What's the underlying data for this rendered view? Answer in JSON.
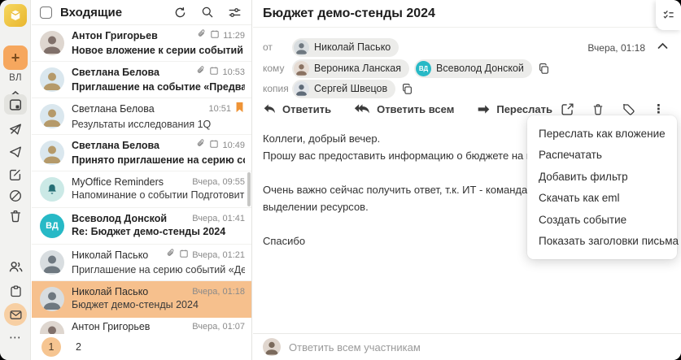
{
  "rail": {
    "logo_name": "myoffice-mail-logo",
    "compose_label": "+",
    "profile_initials": "ВЛ",
    "folders": [
      "inbox",
      "outbox",
      "sent",
      "drafts",
      "spam",
      "trash"
    ],
    "apps": [
      "contacts",
      "calendar",
      "mail",
      "more"
    ],
    "more_glyph": "⋯"
  },
  "icons": {
    "kebab_glyph": "⋮"
  },
  "colors": {
    "accent_orange": "#f6a75e",
    "selected_row": "#f6c08d",
    "bookmark_orange": "#ef9437",
    "teal": "#27b9c6",
    "bell_bg": "#cbe9e6",
    "bell_fg": "#266f76",
    "pagination_circle": "#f6c591"
  },
  "list": {
    "title": "Входящие",
    "emails": [
      {
        "name": "Антон Григорьев",
        "subject": "Новое вложение к серии событий «Аналити…",
        "time": "11:29",
        "attach": true,
        "event": true,
        "unread": true,
        "flag": false,
        "selected": false,
        "avatar": {
          "kind": "photo",
          "bg": "#ded6cf",
          "fg": "#80706a"
        }
      },
      {
        "name": "Светлана Белова",
        "subject": "Приглашение на событие «Предварительно…",
        "time": "10:53",
        "attach": true,
        "event": true,
        "unread": true,
        "flag": false,
        "selected": false,
        "avatar": {
          "kind": "photo",
          "bg": "#dae7ee",
          "fg": "#b59a6a"
        }
      },
      {
        "name": "Светлана Белова",
        "subject": "Результаты исследования 1Q",
        "time": "10:51",
        "attach": false,
        "event": false,
        "unread": false,
        "flag": true,
        "selected": false,
        "avatar": {
          "kind": "photo",
          "bg": "#dae7ee",
          "fg": "#b59a6a"
        }
      },
      {
        "name": "Светлана Белова",
        "subject": "Принято приглашение на серию событий «…",
        "time": "10:49",
        "attach": true,
        "event": true,
        "unread": true,
        "flag": false,
        "selected": false,
        "avatar": {
          "kind": "photo",
          "bg": "#dae7ee",
          "fg": "#b59a6a"
        }
      },
      {
        "name": "MyOffice Reminders",
        "subject": "Напоминание о событии Подготовить отчет…",
        "time": "Вчера, 09:55",
        "attach": false,
        "event": false,
        "unread": false,
        "flag": false,
        "selected": false,
        "avatar": {
          "kind": "bell",
          "bg": "#cbe9e6",
          "fg": "#266f76"
        }
      },
      {
        "name": "Всеволод Донской",
        "subject": "Re: Бюджет демо-стенды 2024",
        "time": "Вчера, 01:41",
        "attach": false,
        "event": false,
        "unread": true,
        "flag": false,
        "selected": false,
        "avatar": {
          "kind": "initials",
          "bg": "#27b9c6",
          "fg": "#ffffff",
          "text": "ВД"
        }
      },
      {
        "name": "Николай Пасько",
        "subject": "Приглашение на серию событий «Демо стен…",
        "time": "Вчера, 01:21",
        "attach": true,
        "event": true,
        "unread": false,
        "flag": false,
        "selected": false,
        "avatar": {
          "kind": "photo",
          "bg": "#d8dde0",
          "fg": "#6e7880"
        }
      },
      {
        "name": "Николай Пасько",
        "subject": "Бюджет демо-стенды 2024",
        "time": "Вчера, 01:18",
        "attach": false,
        "event": false,
        "unread": false,
        "flag": false,
        "selected": true,
        "avatar": {
          "kind": "photo",
          "bg": "#d8dde0",
          "fg": "#6e7880"
        }
      },
      {
        "name": "Антон Григорьев",
        "subject": "",
        "time": "Вчера, 01:07",
        "attach": false,
        "event": false,
        "unread": false,
        "flag": false,
        "selected": false,
        "cut": true,
        "avatar": {
          "kind": "photo",
          "bg": "#ded6cf",
          "fg": "#80706a"
        }
      }
    ],
    "pagination": {
      "current": "1",
      "other": "2"
    }
  },
  "mail": {
    "title": "Бюджет демо-стенды 2024",
    "date": "Вчера, 01:18",
    "labels": {
      "from": "от",
      "to": "кому",
      "cc": "копия"
    },
    "from": [
      {
        "name": "Николай Пасько",
        "avatar": {
          "kind": "photo",
          "bg": "#d8dde0",
          "fg": "#6e7880"
        }
      }
    ],
    "to": [
      {
        "name": "Вероника Ланская",
        "avatar": {
          "kind": "photo",
          "bg": "#e6dcd4",
          "fg": "#8a7262"
        }
      },
      {
        "name": "Всеволод Донской",
        "avatar": {
          "kind": "initials",
          "bg": "#27b9c6",
          "fg": "#ffffff",
          "text": "ВД"
        }
      }
    ],
    "cc": [
      {
        "name": "Сергей Швецов",
        "avatar": {
          "kind": "photo",
          "bg": "#dfe3e8",
          "fg": "#5f6b78"
        }
      }
    ],
    "toolbar": {
      "reply": "Ответить",
      "reply_all": "Ответить всем",
      "forward": "Переслать"
    },
    "body": [
      "Коллеги, добрый вечер.",
      "Прошу вас предоставить информацию о бюджете на наши демонстраци",
      "",
      "Очень важно сейчас получить ответ, т.к. ИТ - команда Всеволода, уже",
      "выделении ресурсов.",
      "",
      "Спасибо"
    ],
    "reply_placeholder": "Ответить всем участникам",
    "reply_avatar": {
      "kind": "photo",
      "bg": "#e0d6ce",
      "fg": "#7b6a5c"
    }
  },
  "menu": {
    "items": [
      "Переслать как вложение",
      "Распечатать",
      "Добавить фильтр",
      "Скачать как eml",
      "Создать событие",
      "Показать заголовки письма"
    ]
  }
}
